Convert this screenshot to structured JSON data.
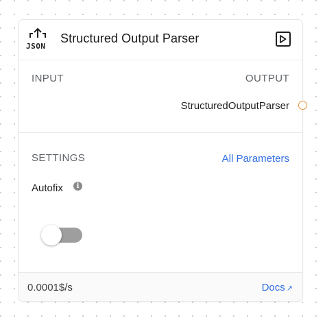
{
  "node": {
    "title": "Structured Output Parser",
    "icon_name": "json-upload-icon",
    "icon_text": "JSON",
    "run_icon_name": "play-icon"
  },
  "io": {
    "input_label": "INPUT",
    "output_label": "OUTPUT",
    "output_type": "StructuredOutputParser",
    "handle_color": "#e8913a"
  },
  "settings": {
    "label": "SETTINGS",
    "all_params_label": "All Parameters",
    "autofix": {
      "label": "Autofix",
      "info_icon_glyph": "i",
      "enabled": false
    }
  },
  "footer": {
    "cost": "0.0001$/s",
    "docs_label": "Docs",
    "docs_icon_glyph": "↗"
  },
  "colors": {
    "link": "#2f6fe0",
    "toggle_off": "#9e9e9e"
  }
}
